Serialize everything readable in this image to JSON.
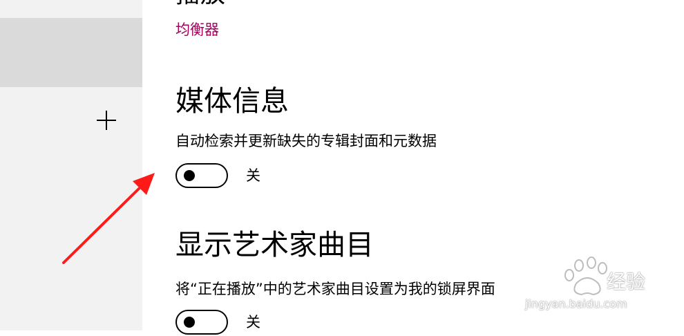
{
  "colors": {
    "accent": "#a0005a",
    "annotation_arrow": "#ff1a1a"
  },
  "sidebar": {
    "add_icon": "plus-icon"
  },
  "playback": {
    "heading": "播放",
    "equalizer_link": "均衡器"
  },
  "media_info": {
    "title": "媒体信息",
    "description": "自动检索并更新缺失的专辑封面和元数据",
    "toggle_state": "关"
  },
  "artist_tracks": {
    "title": "显示艺术家曲目",
    "description": "将“正在播放”中的艺术家曲目设置为我的锁屏界面",
    "toggle_state": "关"
  },
  "watermark": {
    "logo_text": "经验",
    "url": "jingyan.baidu.com",
    "icon": "paw-icon"
  }
}
